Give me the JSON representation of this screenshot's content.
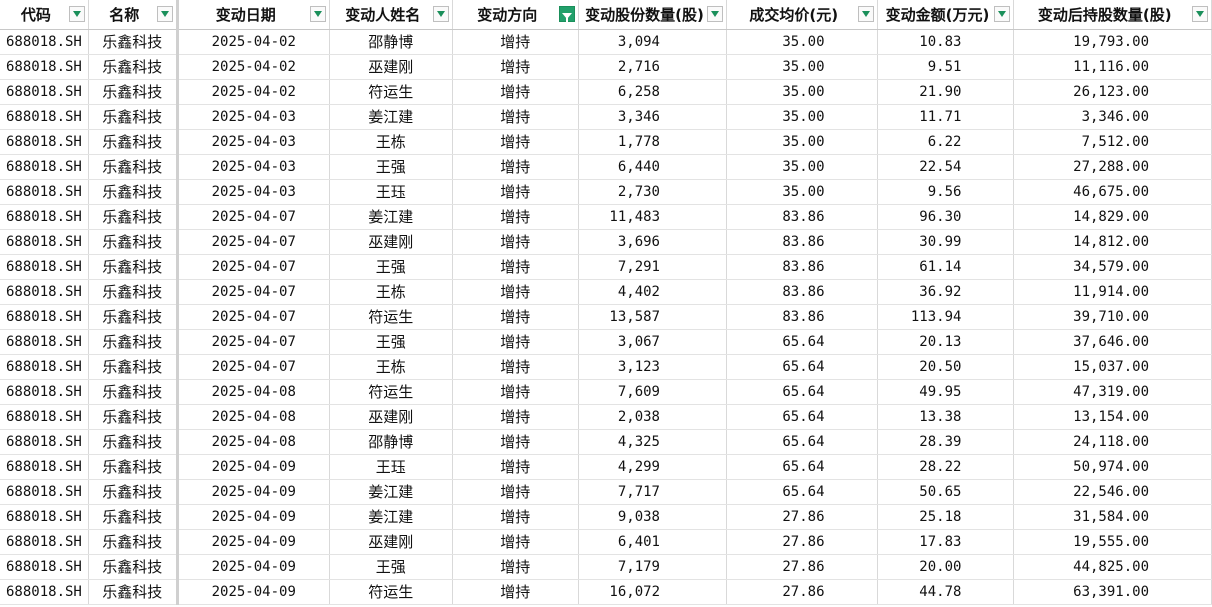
{
  "headers": [
    {
      "label": "代码",
      "filter": "normal"
    },
    {
      "label": "名称",
      "filter": "normal"
    },
    {
      "label": "变动日期",
      "filter": "normal"
    },
    {
      "label": "变动人姓名",
      "filter": "normal"
    },
    {
      "label": "变动方向",
      "filter": "active"
    },
    {
      "label": "变动股份数量(股)",
      "filter": "normal"
    },
    {
      "label": "成交均价(元)",
      "filter": "normal"
    },
    {
      "label": "变动金额(万元)",
      "filter": "normal"
    },
    {
      "label": "变动后持股数量(股)",
      "filter": "normal"
    }
  ],
  "rows": [
    [
      "688018.SH",
      "乐鑫科技",
      "2025-04-02",
      "邵静博",
      "增持",
      "3,094",
      "35.00",
      "10.83",
      "19,793.00"
    ],
    [
      "688018.SH",
      "乐鑫科技",
      "2025-04-02",
      "巫建刚",
      "增持",
      "2,716",
      "35.00",
      "9.51",
      "11,116.00"
    ],
    [
      "688018.SH",
      "乐鑫科技",
      "2025-04-02",
      "符运生",
      "增持",
      "6,258",
      "35.00",
      "21.90",
      "26,123.00"
    ],
    [
      "688018.SH",
      "乐鑫科技",
      "2025-04-03",
      "姜江建",
      "增持",
      "3,346",
      "35.00",
      "11.71",
      "3,346.00"
    ],
    [
      "688018.SH",
      "乐鑫科技",
      "2025-04-03",
      "王栋",
      "增持",
      "1,778",
      "35.00",
      "6.22",
      "7,512.00"
    ],
    [
      "688018.SH",
      "乐鑫科技",
      "2025-04-03",
      "王强",
      "增持",
      "6,440",
      "35.00",
      "22.54",
      "27,288.00"
    ],
    [
      "688018.SH",
      "乐鑫科技",
      "2025-04-03",
      "王珏",
      "增持",
      "2,730",
      "35.00",
      "9.56",
      "46,675.00"
    ],
    [
      "688018.SH",
      "乐鑫科技",
      "2025-04-07",
      "姜江建",
      "增持",
      "11,483",
      "83.86",
      "96.30",
      "14,829.00"
    ],
    [
      "688018.SH",
      "乐鑫科技",
      "2025-04-07",
      "巫建刚",
      "增持",
      "3,696",
      "83.86",
      "30.99",
      "14,812.00"
    ],
    [
      "688018.SH",
      "乐鑫科技",
      "2025-04-07",
      "王强",
      "增持",
      "7,291",
      "83.86",
      "61.14",
      "34,579.00"
    ],
    [
      "688018.SH",
      "乐鑫科技",
      "2025-04-07",
      "王栋",
      "增持",
      "4,402",
      "83.86",
      "36.92",
      "11,914.00"
    ],
    [
      "688018.SH",
      "乐鑫科技",
      "2025-04-07",
      "符运生",
      "增持",
      "13,587",
      "83.86",
      "113.94",
      "39,710.00"
    ],
    [
      "688018.SH",
      "乐鑫科技",
      "2025-04-07",
      "王强",
      "增持",
      "3,067",
      "65.64",
      "20.13",
      "37,646.00"
    ],
    [
      "688018.SH",
      "乐鑫科技",
      "2025-04-07",
      "王栋",
      "增持",
      "3,123",
      "65.64",
      "20.50",
      "15,037.00"
    ],
    [
      "688018.SH",
      "乐鑫科技",
      "2025-04-08",
      "符运生",
      "增持",
      "7,609",
      "65.64",
      "49.95",
      "47,319.00"
    ],
    [
      "688018.SH",
      "乐鑫科技",
      "2025-04-08",
      "巫建刚",
      "增持",
      "2,038",
      "65.64",
      "13.38",
      "13,154.00"
    ],
    [
      "688018.SH",
      "乐鑫科技",
      "2025-04-08",
      "邵静博",
      "增持",
      "4,325",
      "65.64",
      "28.39",
      "24,118.00"
    ],
    [
      "688018.SH",
      "乐鑫科技",
      "2025-04-09",
      "王珏",
      "增持",
      "4,299",
      "65.64",
      "28.22",
      "50,974.00"
    ],
    [
      "688018.SH",
      "乐鑫科技",
      "2025-04-09",
      "姜江建",
      "增持",
      "7,717",
      "65.64",
      "50.65",
      "22,546.00"
    ],
    [
      "688018.SH",
      "乐鑫科技",
      "2025-04-09",
      "姜江建",
      "增持",
      "9,038",
      "27.86",
      "25.18",
      "31,584.00"
    ],
    [
      "688018.SH",
      "乐鑫科技",
      "2025-04-09",
      "巫建刚",
      "增持",
      "6,401",
      "27.86",
      "17.83",
      "19,555.00"
    ],
    [
      "688018.SH",
      "乐鑫科技",
      "2025-04-09",
      "王强",
      "增持",
      "7,179",
      "27.86",
      "20.00",
      "44,825.00"
    ],
    [
      "688018.SH",
      "乐鑫科技",
      "2025-04-09",
      "符运生",
      "增持",
      "16,072",
      "27.86",
      "44.78",
      "63,391.00"
    ]
  ],
  "colors": {
    "filter_active": "#22a06b",
    "filter_arrow": "#1a8f5a",
    "gridline": "#d9d9d9"
  },
  "icons": {
    "filter_normal": "dropdown-arrow-icon",
    "filter_active": "funnel-filter-icon"
  }
}
